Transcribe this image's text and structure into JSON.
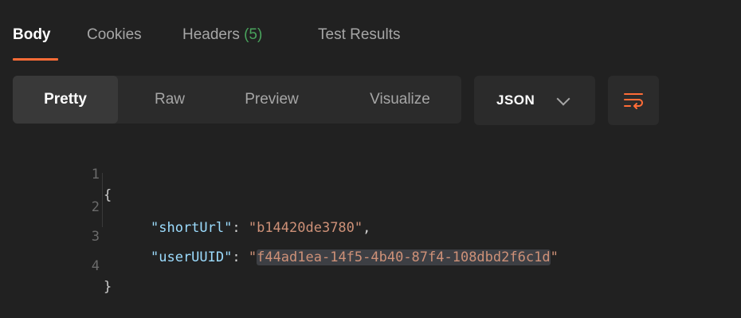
{
  "tabs": [
    {
      "label": "Body",
      "active": true
    },
    {
      "label": "Cookies",
      "active": false
    },
    {
      "label": "Headers",
      "count": "(5)",
      "active": false
    },
    {
      "label": "Test Results",
      "active": false
    }
  ],
  "view_modes": [
    "Pretty",
    "Raw",
    "Preview",
    "Visualize"
  ],
  "selected_view_mode": "Pretty",
  "format_select": {
    "value": "JSON",
    "icon": "chevron-down-icon"
  },
  "wrap_button": {
    "icon": "wrap-lines-icon"
  },
  "code": {
    "lines": [
      {
        "number": "1",
        "open": "{"
      },
      {
        "number": "2",
        "key": "\"shortUrl\"",
        "colon": ": ",
        "value": "\"b14420de3780\"",
        "trail": ","
      },
      {
        "number": "3",
        "key": "\"userUUID\"",
        "colon": ": ",
        "quote_open": "\"",
        "value": "f44ad1ea-14f5-4b40-87f4-108dbd2f6c1d",
        "quote_close": "\""
      },
      {
        "number": "4",
        "close": "}"
      }
    ]
  },
  "colors": {
    "background": "#212121",
    "accent_underline": "#ff6c37",
    "count_green": "#49a35c",
    "json_key": "#9cdcfe",
    "json_string": "#ce9178"
  }
}
